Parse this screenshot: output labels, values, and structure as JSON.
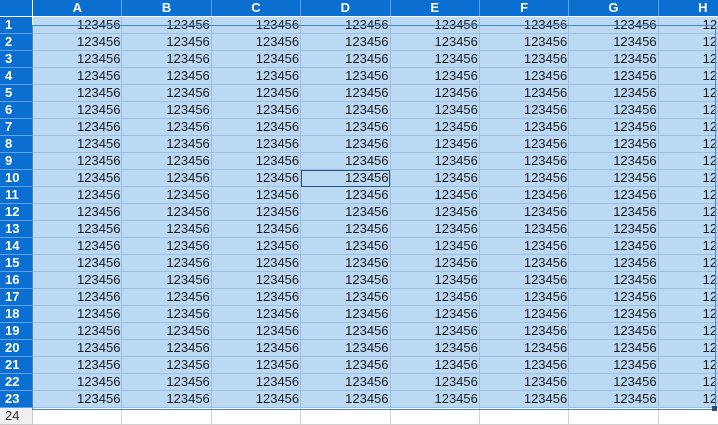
{
  "columns": [
    "A",
    "B",
    "C",
    "D",
    "E",
    "F",
    "G",
    "H"
  ],
  "row_numbers": [
    "1",
    "2",
    "3",
    "4",
    "5",
    "6",
    "7",
    "8",
    "9",
    "10",
    "11",
    "12",
    "13",
    "14",
    "15",
    "16",
    "17",
    "18",
    "19",
    "20",
    "21",
    "22",
    "23"
  ],
  "unselected_row_number": "24",
  "cell_value": "123456",
  "active_cell": {
    "row": "10",
    "column": "D"
  },
  "colors": {
    "header_selected": "#0a6fd1",
    "selection_fill": "#bcd9f4",
    "header_unselected": "#f0f0f0"
  }
}
